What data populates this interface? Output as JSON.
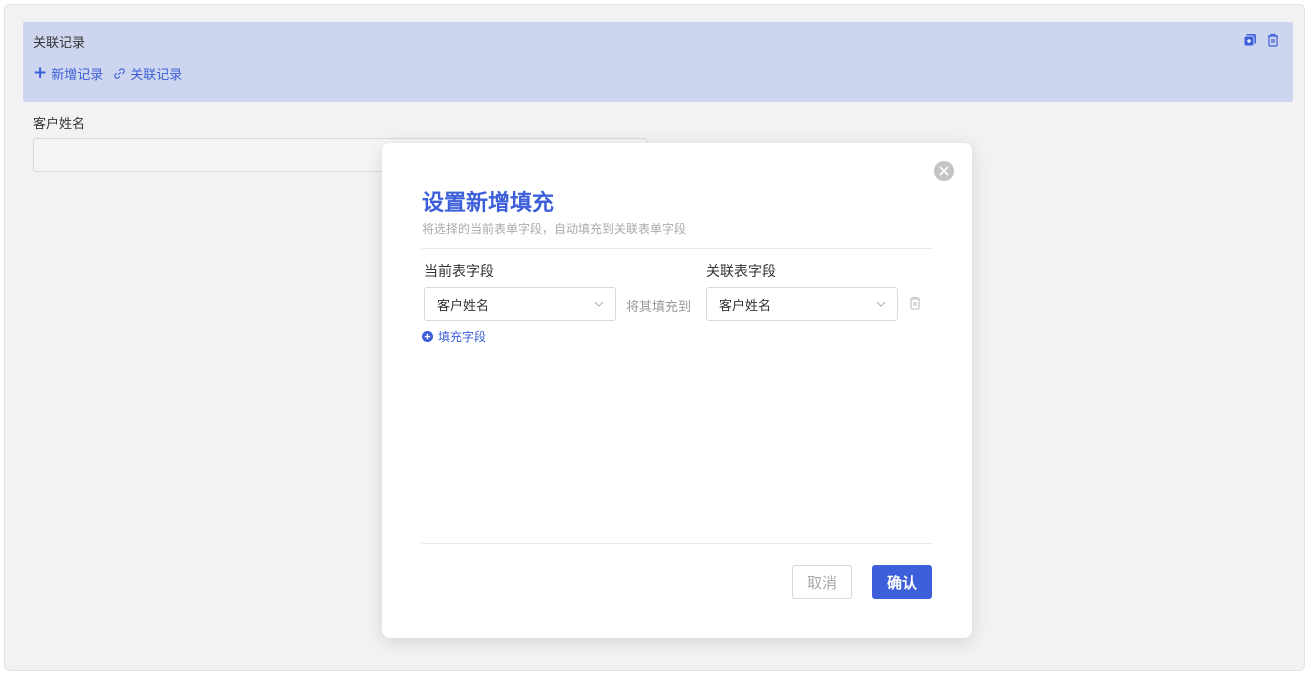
{
  "related_block": {
    "title": "关联记录",
    "add_record_label": "新增记录",
    "link_record_label": "关联记录"
  },
  "form": {
    "customer_name_label": "客户姓名",
    "customer_name_value": ""
  },
  "modal": {
    "title": "设置新增填充",
    "subtitle": "将选择的当前表单字段，自动填充到关联表单字段",
    "current_field_header": "当前表字段",
    "related_field_header": "关联表字段",
    "mapping": {
      "current_value": "客户姓名",
      "connector": "将其填充到",
      "related_value": "客户姓名"
    },
    "add_field_label": "填充字段",
    "cancel_label": "取消",
    "confirm_label": "确认"
  },
  "colors": {
    "accent": "#3d5fd9",
    "related_block_bg": "#cdd6ee"
  }
}
